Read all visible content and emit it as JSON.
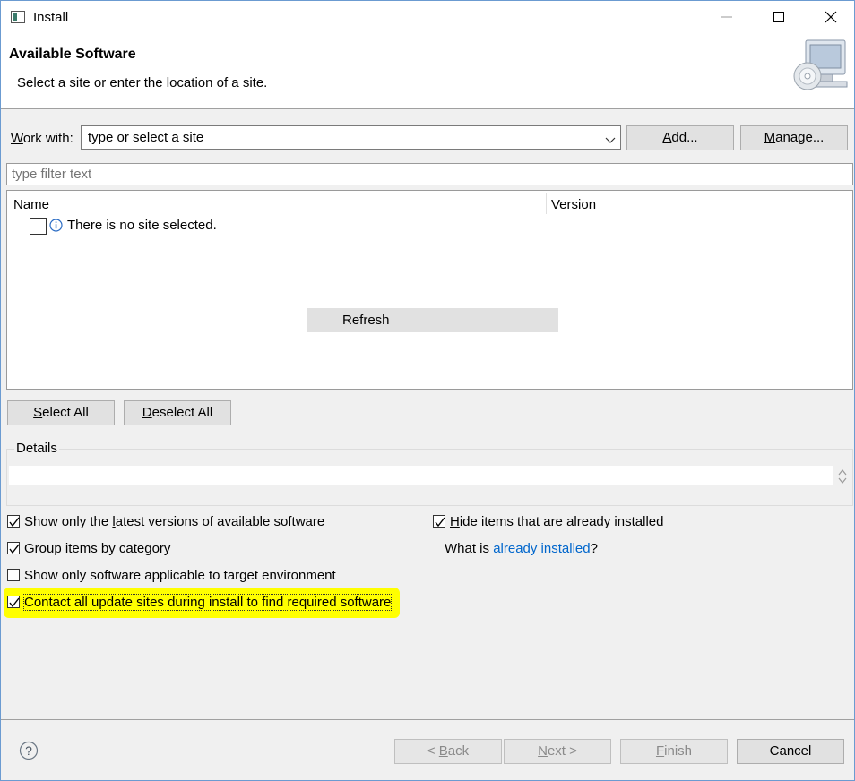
{
  "window": {
    "title": "Install",
    "icon": "eclipse-window-icon",
    "controls": [
      "minimize-icon",
      "maximize-icon",
      "close-icon"
    ]
  },
  "header": {
    "title": "Available Software",
    "subtitle": "Select a site or enter the location of a site.",
    "banner_icon": "install-software-icon"
  },
  "work_with": {
    "label_mnemonic": "W",
    "label_rest": "ork with:",
    "value": "type or select a site",
    "add_mnemonic": "A",
    "add_rest": "dd...",
    "manage_mnemonic": "M",
    "manage_rest": "anage..."
  },
  "filter": {
    "placeholder": "type filter text"
  },
  "table": {
    "columns": [
      "Name",
      "Version"
    ],
    "message": "There is no site selected.",
    "refresh_label": "Refresh"
  },
  "selection": {
    "select_all_mnemonic": "S",
    "select_all_rest": "elect All",
    "deselect_all_mnemonic": "D",
    "deselect_all_rest": "eselect All"
  },
  "details": {
    "label": "Details"
  },
  "options": {
    "latest_before": "Show only the ",
    "latest_mnemonic": "l",
    "latest_after": "atest versions of available software",
    "latest_checked": true,
    "group_mnemonic": "G",
    "group_rest": "roup items by category",
    "group_checked": true,
    "target_label": "Show only software applicable to target environment",
    "target_checked": false,
    "contact_label": "Contact all update sites during install to find required software",
    "contact_checked": true,
    "hide_mnemonic": "H",
    "hide_rest": "ide items that are already installed",
    "hide_checked": true,
    "what_is_prefix": "What is ",
    "already_installed_link": "already installed",
    "what_is_suffix": "?"
  },
  "footer": {
    "help_icon": "help-icon",
    "back_prefix": "< ",
    "back_mnemonic": "B",
    "back_rest": "ack",
    "next_mnemonic": "N",
    "next_rest": "ext >",
    "finish_mnemonic": "F",
    "finish_rest": "inish",
    "cancel_label": "Cancel"
  },
  "colors": {
    "highlight": "#ffff00",
    "link": "#0066cc",
    "dialog_bg": "#f0f0f0",
    "window_border": "#6b9bd1"
  }
}
